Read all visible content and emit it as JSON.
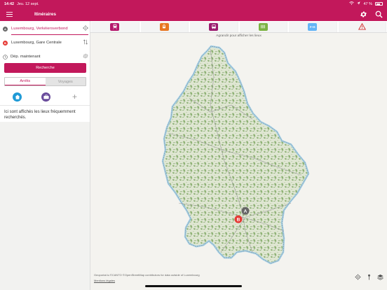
{
  "status_bar": {
    "time": "14:42",
    "date": "Jeu. 12 sept.",
    "battery": "47 %"
  },
  "header": {
    "title": "Itinéraires",
    "menu_icon": "hamburger-menu-icon",
    "settings_icon": "gear-icon",
    "search_icon": "search-icon"
  },
  "route": {
    "origin_marker": "A",
    "origin": "Luxembourg, Verkéiersverbond",
    "destination_marker": "B",
    "destination": "Luxembourg, Gare Centrale",
    "departure": "Dép. maintenant"
  },
  "search_button": "Recherche",
  "tabs": [
    {
      "label": "Arrêts",
      "active": true
    },
    {
      "label": "Voyages",
      "active": false
    }
  ],
  "favorites": {
    "home_icon": "home-icon",
    "work_icon": "briefcase-icon",
    "add_icon": "plus-icon",
    "info": "Ici sont affichés les lieux fréquemment recherchés."
  },
  "transport_modes": [
    {
      "icon": "train-icon",
      "color": "#b5166b"
    },
    {
      "icon": "tram-icon",
      "color": "#e87722"
    },
    {
      "icon": "bus-icon",
      "color": "#9b1b6e"
    },
    {
      "icon": "bike-sharing-icon",
      "color": "#7cb342"
    },
    {
      "icon": "park-and-ride-icon",
      "label": "P+R",
      "color": "#64b5f6"
    },
    {
      "icon": "warning-icon",
      "color": "#d32f2f"
    }
  ],
  "map": {
    "hint": "Agrandir pour afficher les lieux",
    "marker_a": "A",
    "marker_b": "B",
    "attribution": "Geoportal.lu ©CANTO ©OpenStreetMap contributors for data outside of Luxembourg",
    "mentions": "Mentions légales"
  },
  "colors": {
    "brand": "#c2185b",
    "forest": "#8fb276",
    "border_ring": "#a3d0e8"
  }
}
